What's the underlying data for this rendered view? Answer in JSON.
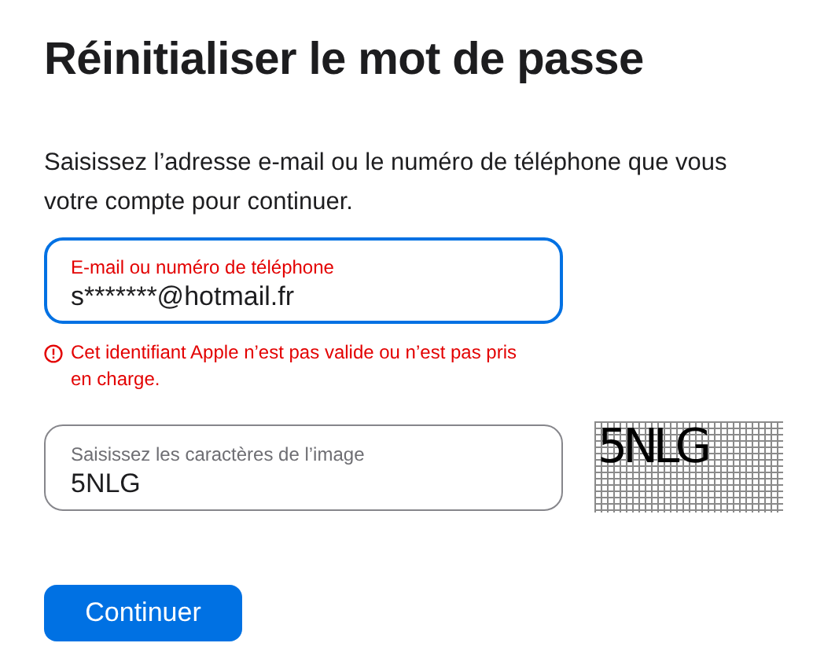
{
  "title": "Réinitialiser le mot de passe",
  "intro_lines": [
    "Saisissez l’adresse e-mail ou le numéro de téléphone que vous",
    "votre compte pour continuer."
  ],
  "email_field": {
    "label": "E-mail ou numéro de téléphone",
    "value": "s*******@hotmail.fr",
    "focused": true,
    "invalid": true
  },
  "error_message": "Cet identifiant Apple n’est pas valide ou n’est pas pris en charge.",
  "captcha_field": {
    "label": "Saisissez les caractères de l’image",
    "value": "5NLG",
    "focused": false,
    "invalid": false
  },
  "captcha_image": {
    "text": "5NLG"
  },
  "button": "Continuer"
}
